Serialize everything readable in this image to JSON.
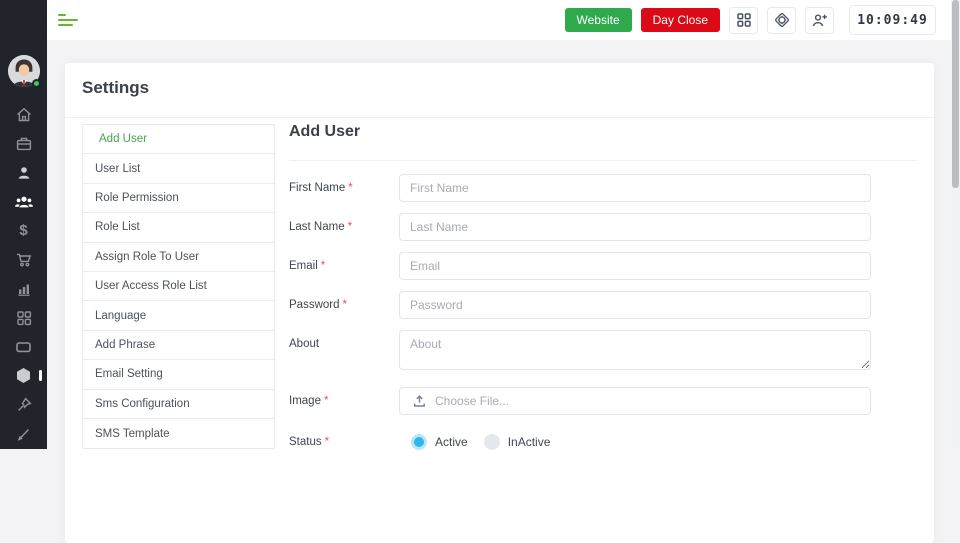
{
  "header": {
    "website_button": "Website",
    "day_close_button": "Day Close",
    "clock": "10:09:49",
    "icons": [
      "hamburger-menu-icon",
      "apps-grid-icon",
      "compass-target-icon",
      "add-person-icon"
    ]
  },
  "sidebar": {
    "dollar_glyph": "$",
    "icons": [
      "avatar",
      "home-icon",
      "briefcase-icon",
      "user-icon",
      "users-group-icon",
      "dollar-icon",
      "cart-icon",
      "bar-chart-icon",
      "grid-icon",
      "tablet-icon",
      "hexagon-icon",
      "pin-icon",
      "brush-icon"
    ]
  },
  "page": {
    "title": "Settings"
  },
  "settings_nav": {
    "items": [
      {
        "label": "Add User",
        "active": true
      },
      {
        "label": "User List",
        "active": false
      },
      {
        "label": "Role Permission",
        "active": false
      },
      {
        "label": "Role List",
        "active": false
      },
      {
        "label": "Assign Role To User",
        "active": false
      },
      {
        "label": "User Access Role List",
        "active": false
      },
      {
        "label": "Language",
        "active": false
      },
      {
        "label": "Add Phrase",
        "active": false
      },
      {
        "label": "Email Setting",
        "active": false
      },
      {
        "label": "Sms Configuration",
        "active": false
      },
      {
        "label": "SMS Template",
        "active": false
      }
    ]
  },
  "form": {
    "title": "Add User",
    "required_marker": "*",
    "fields": {
      "first_name": {
        "label": "First Name",
        "required": true,
        "placeholder": "First Name",
        "value": ""
      },
      "last_name": {
        "label": "Last Name",
        "required": true,
        "placeholder": "Last Name",
        "value": ""
      },
      "email": {
        "label": "Email",
        "required": true,
        "placeholder": "Email",
        "value": ""
      },
      "password": {
        "label": "Password",
        "required": true,
        "placeholder": "Password",
        "value": ""
      },
      "about": {
        "label": "About",
        "required": false,
        "placeholder": "About",
        "value": ""
      },
      "image": {
        "label": "Image",
        "required": true,
        "placeholder": "Choose File...",
        "value": ""
      },
      "status": {
        "label": "Status",
        "required": true,
        "options": [
          {
            "label": "Active",
            "selected": true
          },
          {
            "label": "InActive",
            "selected": false
          }
        ]
      }
    }
  },
  "colors": {
    "sidebar_bg": "#21252b",
    "button_green": "#2eaa4d",
    "button_red": "#dc0a17",
    "hamburger_green": "#63b72f",
    "active_nav_green": "#47a44b",
    "radio_cyan": "#2eb6ea",
    "required_red": "#e8505b",
    "online_dot_green": "#3ec95f"
  }
}
